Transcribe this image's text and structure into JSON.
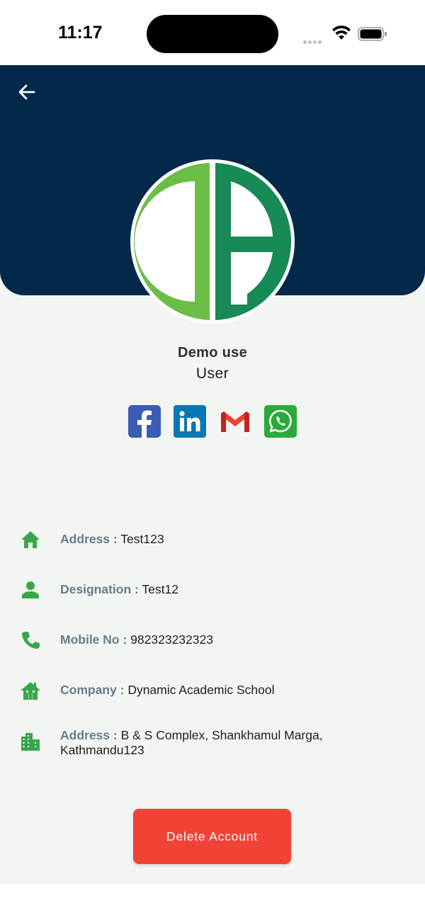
{
  "status_bar": {
    "time": "11:17"
  },
  "header": {
    "back_icon": "arrow-left-icon",
    "header_color": "#02294a"
  },
  "profile": {
    "avatar_icon": "da-logo",
    "name": "Demo use",
    "role": "User"
  },
  "social": [
    {
      "name": "facebook",
      "icon": "facebook-icon",
      "color": "#3b5bb5"
    },
    {
      "name": "linkedin",
      "icon": "linkedin-icon",
      "color": "#0a77b5"
    },
    {
      "name": "gmail",
      "icon": "gmail-icon",
      "color": "#e94335"
    },
    {
      "name": "whatsapp",
      "icon": "whatsapp-icon",
      "color": "#2aaa3a"
    }
  ],
  "info": [
    {
      "icon": "home-icon",
      "label": "Address :",
      "value": "Test123"
    },
    {
      "icon": "person-icon",
      "label": "Designation :",
      "value": "Test12"
    },
    {
      "icon": "phone-icon",
      "label": "Mobile No :",
      "value": "982323232323"
    },
    {
      "icon": "house-icon",
      "label": "Company :",
      "value": "Dynamic Academic School"
    },
    {
      "icon": "building-icon",
      "label": "Address :",
      "value": "B & S Complex, Shankhamul Marga, Kathmandu123"
    }
  ],
  "actions": {
    "delete_label": "Delete Account",
    "delete_color": "#f04336"
  },
  "colors": {
    "icon_green": "#3aa64b",
    "label_gray": "#667d8c",
    "background": "#f3f5f2"
  }
}
